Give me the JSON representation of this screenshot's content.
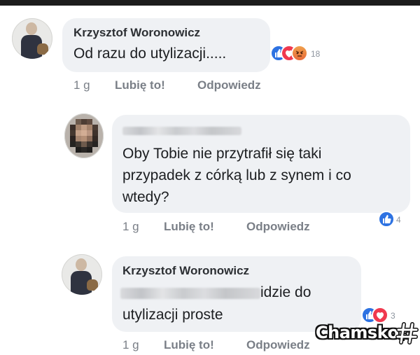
{
  "comments": [
    {
      "author": "Krzysztof Woronowicz",
      "lines": [
        "Od razu do utylizacji....."
      ],
      "time": "1 g",
      "like_label": "Lubię to!",
      "reply_label": "Odpowiedz",
      "reactions": [
        "like",
        "love",
        "angry"
      ],
      "reaction_count": "18"
    },
    {
      "author": "",
      "lines": [
        "Oby Tobie nie przytrafił się taki",
        "przypadek z córką lub z synem i co",
        "wtedy?"
      ],
      "time": "1 g",
      "like_label": "Lubię to!",
      "reply_label": "Odpowiedz",
      "reactions": [
        "like"
      ],
      "reaction_count": "4"
    },
    {
      "author": "Krzysztof Woronowicz",
      "lines": [
        "idzie do",
        "utylizacji proste"
      ],
      "time": "1 g",
      "like_label": "Lubię to!",
      "reply_label": "Odpowiedz",
      "reactions": [
        "like",
        "love"
      ],
      "reaction_count": "3"
    }
  ],
  "watermark": {
    "text": "Chamsko",
    "suffix": ".pl"
  },
  "colors": {
    "bubble": "#eff1f4",
    "meta": "#7a7f87",
    "like": "#2d72e2",
    "love": "#f0394f"
  }
}
